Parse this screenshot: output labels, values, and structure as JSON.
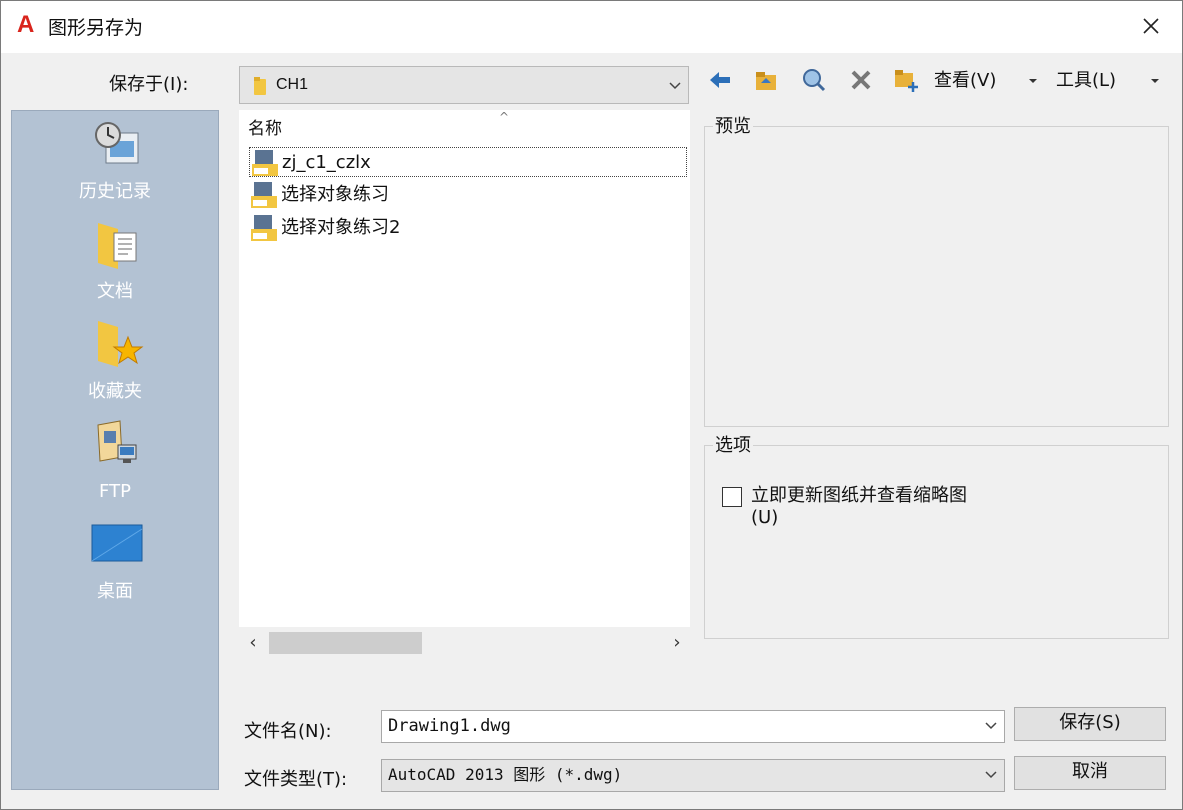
{
  "window": {
    "app_icon_letter": "A",
    "title": "图形另存为"
  },
  "toolbar": {
    "save_in_label": "保存于(I):",
    "save_in_value": "CH1",
    "view_label": "查看(V)",
    "tools_label": "工具(L)"
  },
  "places": [
    {
      "label": "历史记录",
      "icon": "history-icon"
    },
    {
      "label": "文档",
      "icon": "documents-icon"
    },
    {
      "label": "收藏夹",
      "icon": "favorites-icon"
    },
    {
      "label": "FTP",
      "icon": "ftp-icon"
    },
    {
      "label": "桌面",
      "icon": "desktop-icon"
    }
  ],
  "file_list": {
    "column_header": "名称",
    "files": [
      {
        "name": "zj_c1_czlx",
        "selected": true
      },
      {
        "name": "选择对象练习",
        "selected": false
      },
      {
        "name": "选择对象练习2",
        "selected": false
      }
    ]
  },
  "preview": {
    "label": "预览"
  },
  "options": {
    "label": "选项",
    "checkbox_label": "立即更新图纸并查看缩略图(U)",
    "checked": false
  },
  "bottom": {
    "filename_label": "文件名(N):",
    "filename_value": "Drawing1.dwg",
    "filetype_label": "文件类型(T):",
    "filetype_value": "AutoCAD 2013 图形 (*.dwg)",
    "save_button": "保存(S)",
    "cancel_button": "取消"
  },
  "colors": {
    "places_bg": "#b3c2d3",
    "app_icon": "#d9251d",
    "folder": "#f2c641"
  }
}
